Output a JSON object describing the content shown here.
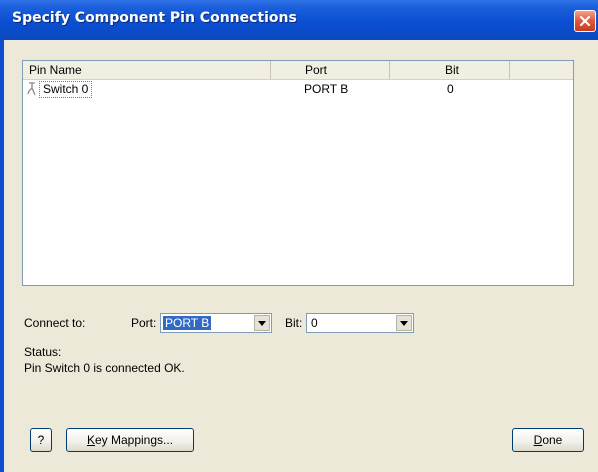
{
  "window": {
    "title": "Specify Component Pin Connections"
  },
  "list": {
    "columns": [
      "Pin Name",
      "Port",
      "Bit",
      ""
    ],
    "rows": [
      {
        "pin": "Switch 0",
        "port": "PORT B",
        "bit": "0"
      }
    ]
  },
  "connect": {
    "label": "Connect to:",
    "port_label": "Port:",
    "port_value": "PORT B",
    "bit_label": "Bit:",
    "bit_value": "0"
  },
  "status": {
    "label": "Status:",
    "text": "Pin Switch 0 is connected OK."
  },
  "buttons": {
    "help": "?",
    "key_mappings_accel": "K",
    "key_mappings_rest": "ey Mappings...",
    "done_accel": "D",
    "done_rest": "one"
  },
  "colors": {
    "title_bar": "#0a4fd2",
    "selection": "#316ac5",
    "dialog_bg": "#ece9d8"
  },
  "icons": {
    "pin": "pin-icon",
    "close": "close-icon",
    "dropdown": "chevron-down-icon"
  }
}
